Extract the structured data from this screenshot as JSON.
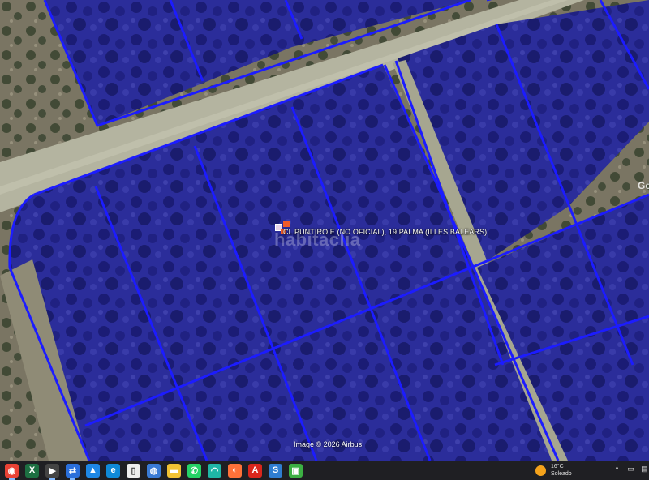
{
  "map": {
    "address_label": "CL PUNTIRO E (NO OFICIAL), 19  PALMA (ILLES BALEARS)",
    "watermark": "habitaclia",
    "attribution": "Image © 2026 Airbus",
    "corner_logo": "Goo",
    "parcel_fill": "#2a1fc8",
    "parcel_line": "#1a1aff",
    "road_color": "#b8b8a4"
  },
  "taskbar": {
    "icons": [
      {
        "name": "start-chrome-icon",
        "glyph": "◉",
        "color": "#e94235"
      },
      {
        "name": "excel-icon",
        "glyph": "X",
        "color": "#1d6f42"
      },
      {
        "name": "video-icon",
        "glyph": "▶",
        "color": "#444"
      },
      {
        "name": "teamviewer-icon",
        "glyph": "⇄",
        "color": "#2a6fdb"
      },
      {
        "name": "photos-icon",
        "glyph": "▲",
        "color": "#1e88e5"
      },
      {
        "name": "edge-icon",
        "glyph": "e",
        "color": "#0f8ad8"
      },
      {
        "name": "file-icon",
        "glyph": "▯",
        "color": "#eeeeee"
      },
      {
        "name": "globe-icon",
        "glyph": "◍",
        "color": "#3a7bd5"
      },
      {
        "name": "folder-icon",
        "glyph": "▬",
        "color": "#f2c233"
      },
      {
        "name": "whatsapp-icon",
        "glyph": "✆",
        "color": "#25d366"
      },
      {
        "name": "wifi-app-icon",
        "glyph": "◠",
        "color": "#1fb7a6"
      },
      {
        "name": "firefox-icon",
        "glyph": "◐",
        "color": "#ff7139"
      },
      {
        "name": "acrobat-icon",
        "glyph": "A",
        "color": "#d9261c"
      },
      {
        "name": "s-app-icon",
        "glyph": "S",
        "color": "#2f7dd1"
      },
      {
        "name": "green-app-icon",
        "glyph": "▣",
        "color": "#3cb043"
      }
    ],
    "weather": {
      "temp": "16°C",
      "condition": "Soleado"
    }
  }
}
